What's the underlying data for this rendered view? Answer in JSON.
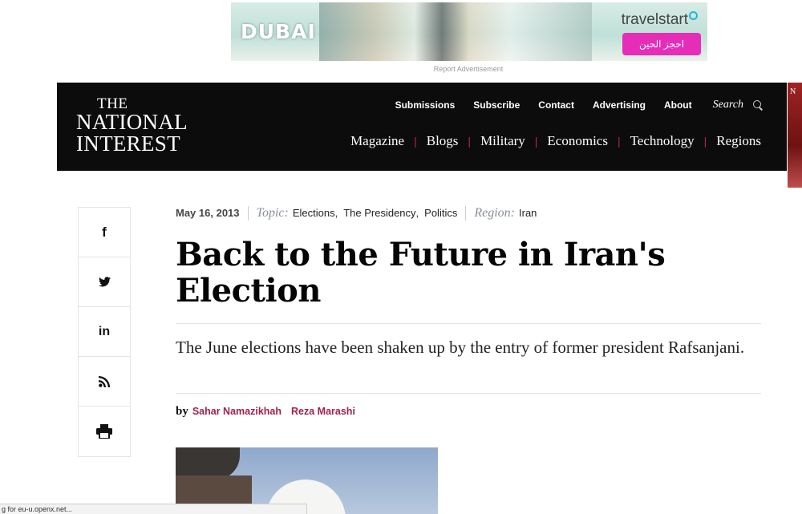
{
  "ad": {
    "dubai_text": "DUBAI",
    "brand": "travelstart",
    "cta": "احجز الحين",
    "report_label": "Report Advertisement"
  },
  "header": {
    "logo": {
      "line1": "THE",
      "line2": "NATIONAL",
      "line3": "INTEREST"
    },
    "top_nav": [
      "Submissions",
      "Subscribe",
      "Contact",
      "Advertising",
      "About"
    ],
    "search_label": "Search",
    "main_nav": [
      "Magazine",
      "Blogs",
      "Military",
      "Economics",
      "Technology",
      "Regions"
    ],
    "accent_color": "#b1284b"
  },
  "side_promo": {
    "text": "N"
  },
  "share": [
    "f",
    "twitter-icon",
    "in",
    "rss-icon",
    "print-icon"
  ],
  "article": {
    "date": "May 16, 2013",
    "topic_label": "Topic:",
    "topics": [
      "Elections",
      "The Presidency",
      "Politics"
    ],
    "region_label": "Region:",
    "region": "Iran",
    "title": "Back to the Future in Iran's Election",
    "deck": "The June elections have been shaken up by the entry of former president Rafsanjani.",
    "by_label": "by",
    "authors": [
      "Sahar Namazikhah",
      "Reza Marashi"
    ],
    "author_color": "#a1214a"
  },
  "status_bar": {
    "text": "g for eu-u.openx.net..."
  }
}
